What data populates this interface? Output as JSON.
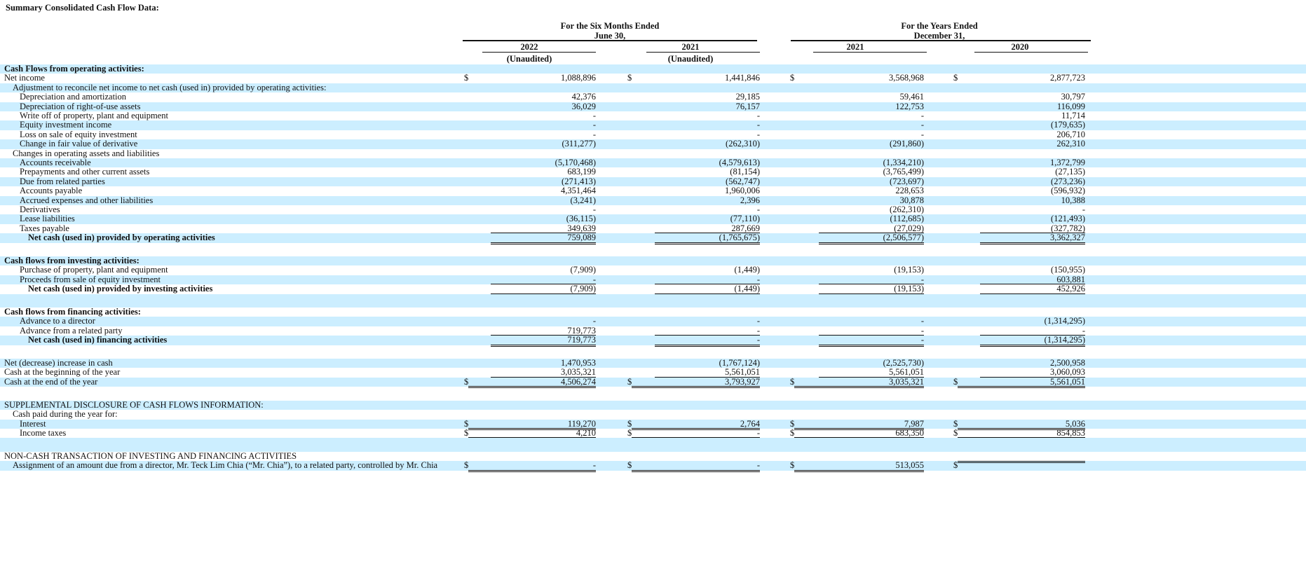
{
  "title": "Summary Consolidated Cash Flow Data:",
  "headers": {
    "six_months_line1": "For the Six Months Ended",
    "six_months_line2": "June 30,",
    "years_line1": "For the Years Ended",
    "years_line2": "December 31,",
    "col1": "2022",
    "col1_sub": "(Unaudited)",
    "col2": "2021",
    "col2_sub": "(Unaudited)",
    "col3": "2021",
    "col4": "2020"
  },
  "rows": [
    {
      "label": "Cash Flows from operating activities:",
      "indent": 0,
      "bold": true,
      "shade": true,
      "values": [
        "",
        "",
        "",
        ""
      ]
    },
    {
      "label": "Net income",
      "indent": 0,
      "shade": false,
      "dollar": true,
      "values": [
        "1,088,896",
        "1,441,846",
        "3,568,968",
        "2,877,723"
      ]
    },
    {
      "label": "Adjustment to reconcile net income to net cash (used in) provided by operating activities:",
      "indent": 1,
      "shade": true,
      "values": [
        "",
        "",
        "",
        ""
      ]
    },
    {
      "label": "Depreciation and amortization",
      "indent": 2,
      "shade": false,
      "values": [
        "42,376",
        "29,185",
        "59,461",
        "30,797"
      ]
    },
    {
      "label": "Depreciation of right-of-use assets",
      "indent": 2,
      "shade": true,
      "values": [
        "36,029",
        "76,157",
        "122,753",
        "116,099"
      ]
    },
    {
      "label": "Write off of property, plant and equipment",
      "indent": 2,
      "shade": false,
      "values": [
        "-",
        "-",
        "-",
        "11,714"
      ]
    },
    {
      "label": "Equity investment income",
      "indent": 2,
      "shade": true,
      "values": [
        "-",
        "-",
        "-",
        "(179,635)"
      ]
    },
    {
      "label": "Loss on sale of equity investment",
      "indent": 2,
      "shade": false,
      "values": [
        "-",
        "-",
        "-",
        "206,710"
      ]
    },
    {
      "label": "Change in fair value of derivative",
      "indent": 2,
      "shade": true,
      "values": [
        "(311,277)",
        "(262,310)",
        "(291,860)",
        "262,310"
      ]
    },
    {
      "label": "Changes in operating assets and liabilities",
      "indent": 1,
      "shade": false,
      "values": [
        "",
        "",
        "",
        ""
      ]
    },
    {
      "label": "Accounts receivable",
      "indent": 2,
      "shade": true,
      "values": [
        "(5,170,468)",
        "(4,579,613)",
        "(1,334,210)",
        "1,372,799"
      ]
    },
    {
      "label": "Prepayments and other current assets",
      "indent": 2,
      "shade": false,
      "values": [
        "683,199",
        "(81,154)",
        "(3,765,499)",
        "(27,135)"
      ]
    },
    {
      "label": "Due from related parties",
      "indent": 2,
      "shade": true,
      "values": [
        "(271,413)",
        "(562,747)",
        "(723,697)",
        "(273,236)"
      ]
    },
    {
      "label": "Accounts payable",
      "indent": 2,
      "shade": false,
      "values": [
        "4,351,464",
        "1,960,006",
        "228,653",
        "(596,932)"
      ]
    },
    {
      "label": "Accrued expenses and other liabilities",
      "indent": 2,
      "shade": true,
      "values": [
        "(3,241)",
        "2,396",
        "30,878",
        "10,388"
      ]
    },
    {
      "label": "Derivatives",
      "indent": 2,
      "shade": false,
      "values": [
        "-",
        "-",
        "(262,310)",
        "-"
      ]
    },
    {
      "label": "Lease liabilities",
      "indent": 2,
      "shade": true,
      "values": [
        "(36,115)",
        "(77,110)",
        "(112,685)",
        "(121,493)"
      ]
    },
    {
      "label": "Taxes payable",
      "indent": 2,
      "shade": false,
      "underline": "single",
      "values": [
        "349,639",
        "287,669",
        "(27,029)",
        "(327,782)"
      ]
    },
    {
      "label": "Net cash (used in) provided by operating activities",
      "indent": 3,
      "bold": true,
      "shade": true,
      "underline": "double",
      "values": [
        "759,089",
        "(1,765,675)",
        "(2,506,577)",
        "3,362,327"
      ]
    },
    {
      "label": "",
      "indent": 0,
      "shade": false,
      "values": [
        "",
        "",
        "",
        ""
      ]
    },
    {
      "label": "Cash flows from investing activities:",
      "indent": 0,
      "bold": true,
      "shade": true,
      "values": [
        "",
        "",
        "",
        ""
      ]
    },
    {
      "label": "Purchase of property, plant and equipment",
      "indent": 2,
      "shade": false,
      "values": [
        "(7,909)",
        "(1,449)",
        "(19,153)",
        "(150,955)"
      ]
    },
    {
      "label": "Proceeds from sale of equity investment",
      "indent": 2,
      "shade": true,
      "underline": "single",
      "values": [
        "-",
        "-",
        "-",
        "603,881"
      ]
    },
    {
      "label": "Net cash (used in) provided by investing activities",
      "indent": 3,
      "bold": true,
      "shade": false,
      "underline": "double",
      "values": [
        "(7,909)",
        "(1,449)",
        "(19,153)",
        "452,926"
      ]
    },
    {
      "label": "",
      "indent": 0,
      "shade": true,
      "values": [
        "",
        "",
        "",
        ""
      ]
    },
    {
      "label": "Cash flows from financing activities:",
      "indent": 0,
      "bold": true,
      "shade": false,
      "values": [
        "",
        "",
        "",
        ""
      ]
    },
    {
      "label": "Advance to a director",
      "indent": 2,
      "shade": true,
      "values": [
        "-",
        "-",
        "-",
        "(1,314,295)"
      ]
    },
    {
      "label": "Advance from a related party",
      "indent": 2,
      "shade": false,
      "underline": "single",
      "values": [
        "719,773",
        "-",
        "-",
        "-"
      ]
    },
    {
      "label": "Net cash (used in) financing activities",
      "indent": 3,
      "bold": true,
      "shade": true,
      "underline": "double",
      "values": [
        "719,773",
        "-",
        "-",
        "(1,314,295)"
      ]
    },
    {
      "label": "",
      "indent": 0,
      "shade": false,
      "values": [
        "",
        "",
        "",
        ""
      ]
    },
    {
      "label": "Net (decrease) increase in cash",
      "indent": 0,
      "shade": true,
      "values": [
        "1,470,953",
        "(1,767,124)",
        "(2,525,730)",
        "2,500,958"
      ]
    },
    {
      "label": "Cash at the beginning of the year",
      "indent": 0,
      "shade": false,
      "underline": "single",
      "values": [
        "3,035,321",
        "5,561,051",
        "5,561,051",
        "3,060,093"
      ]
    },
    {
      "label": "Cash at the end of the year",
      "indent": 0,
      "shade": true,
      "dollar": true,
      "underline": "double",
      "values": [
        "4,506,274",
        "3,793,927",
        "3,035,321",
        "5,561,051"
      ]
    },
    {
      "label": "",
      "indent": 0,
      "shade": false,
      "values": [
        "",
        "",
        "",
        ""
      ]
    },
    {
      "label": "SUPPLEMENTAL DISCLOSURE OF CASH FLOWS INFORMATION:",
      "indent": 0,
      "shade": true,
      "values": [
        "",
        "",
        "",
        ""
      ]
    },
    {
      "label": "Cash paid during the year for:",
      "indent": 1,
      "shade": false,
      "values": [
        "",
        "",
        "",
        ""
      ]
    },
    {
      "label": "Interest",
      "indent": 2,
      "shade": true,
      "dollar": true,
      "underline": "double",
      "values": [
        "119,270",
        "2,764",
        "7,987",
        "5,036"
      ]
    },
    {
      "label": "Income taxes",
      "indent": 2,
      "shade": false,
      "dollar": true,
      "underline": "double",
      "values": [
        "4,210",
        "-",
        "683,350",
        "854,853"
      ]
    },
    {
      "label": "",
      "indent": 0,
      "shade": true,
      "values": [
        "",
        "",
        "",
        ""
      ]
    },
    {
      "label": "NON-CASH TRANSACTION OF INVESTING AND FINANCING ACTIVITIES",
      "indent": 0,
      "shade": false,
      "values": [
        "",
        "",
        "",
        ""
      ]
    },
    {
      "label": "Assignment of an amount due from a director, Mr. Teck Lim Chia (“Mr. Chia”), to a related party, controlled by Mr. Chia",
      "indent": 1,
      "shade": true,
      "dollar": true,
      "underline": "double",
      "values": [
        "-",
        "-",
        "513,055",
        ""
      ]
    }
  ],
  "dollar_sign": "$"
}
